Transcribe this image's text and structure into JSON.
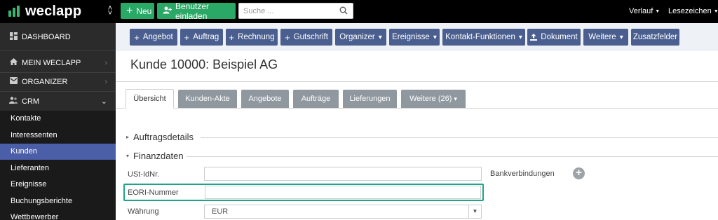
{
  "app": {
    "logo_text": "weclapp",
    "brand_color": "#2aa866"
  },
  "topbar": {
    "new_label": "Neu",
    "invite_label": "Benutzer einladen",
    "search_placeholder": "Suche ...",
    "history_label": "Verlauf",
    "bookmarks_label": "Lesezeichen"
  },
  "sidebar": {
    "items": [
      {
        "label": "DASHBOARD",
        "icon": "dashboard-icon"
      },
      {
        "label": "MEIN WECLAPP",
        "icon": "home-icon"
      },
      {
        "label": "ORGANIZER",
        "icon": "inbox-icon"
      },
      {
        "label": "CRM",
        "icon": "users-icon"
      }
    ],
    "crm_sub": [
      "Kontakte",
      "Interessenten",
      "Kunden",
      "Lieferanten",
      "Ereignisse",
      "Buchungsberichte",
      "Wettbewerber"
    ],
    "active_sub": "Kunden",
    "active_color": "#4b5ea8"
  },
  "toolbar": {
    "buttons": [
      {
        "label": "Angebot"
      },
      {
        "label": "Auftrag"
      },
      {
        "label": "Rechnung"
      },
      {
        "label": "Gutschrift"
      },
      {
        "label": "Organizer"
      },
      {
        "label": "Ereignisse"
      },
      {
        "label": "Kontakt-Funktionen"
      },
      {
        "label": "Dokument"
      },
      {
        "label": "Weitere"
      },
      {
        "label": "Zusatzfelder"
      }
    ],
    "button_color": "#4a5f8f"
  },
  "page": {
    "title": "Kunde 10000: Beispiel AG"
  },
  "tabs": [
    {
      "label": "Übersicht",
      "active": true
    },
    {
      "label": "Kunden-Akte"
    },
    {
      "label": "Angebote"
    },
    {
      "label": "Aufträge"
    },
    {
      "label": "Lieferungen"
    },
    {
      "label": "Weitere (26)"
    }
  ],
  "sections": {
    "order_details": "Auftragsdetails",
    "finance": "Finanzdaten"
  },
  "fields": {
    "vat_label": "USt-IdNr.",
    "vat_value": "",
    "eori_label": "EORI-Nummer",
    "eori_value": "",
    "currency_label": "Währung",
    "currency_value": "EUR",
    "bank_label": "Bankverbindungen"
  },
  "highlight_color": "#1fa38a"
}
